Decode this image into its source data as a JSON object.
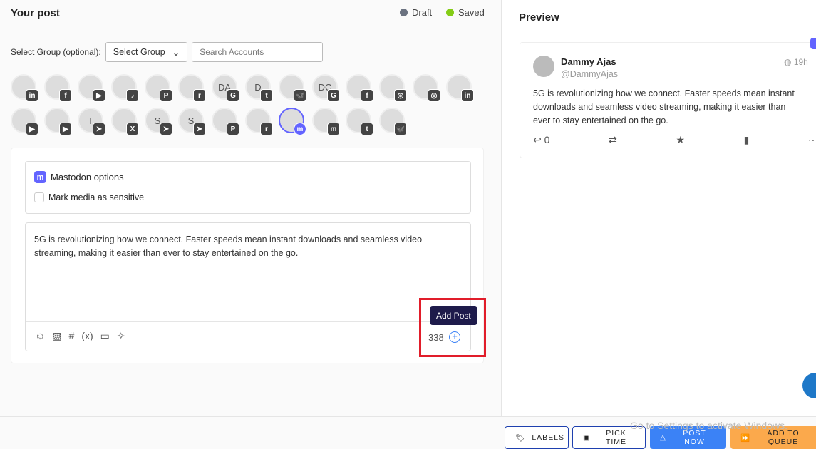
{
  "left": {
    "title": "Your post",
    "status": [
      {
        "label": "Draft",
        "color": "#6b7280"
      },
      {
        "label": "Saved",
        "color": "#84cc16"
      }
    ],
    "group_label": "Select Group (optional):",
    "group_select": "Select Group",
    "search_placeholder": "Search Accounts",
    "accounts": [
      {
        "initials": "",
        "platform": "linkedin",
        "badge": "in"
      },
      {
        "initials": "",
        "platform": "facebook",
        "badge": "f"
      },
      {
        "initials": "",
        "platform": "youtube",
        "badge": "▶"
      },
      {
        "initials": "",
        "platform": "tiktok",
        "badge": "♪"
      },
      {
        "initials": "",
        "platform": "pinterest",
        "badge": "P"
      },
      {
        "initials": "",
        "platform": "reddit",
        "badge": "r"
      },
      {
        "initials": "DA",
        "platform": "google-business",
        "badge": "G"
      },
      {
        "initials": "D",
        "platform": "tumblr",
        "badge": "t"
      },
      {
        "initials": "",
        "platform": "bluesky",
        "badge": "🦋"
      },
      {
        "initials": "DC",
        "platform": "google-business",
        "badge": "G"
      },
      {
        "initials": "",
        "platform": "facebook",
        "badge": "f"
      },
      {
        "initials": "",
        "platform": "instagram",
        "badge": "◎"
      },
      {
        "initials": "",
        "platform": "instagram",
        "badge": "◎"
      },
      {
        "initials": "",
        "platform": "linkedin",
        "badge": "in"
      },
      {
        "initials": "",
        "platform": "youtube",
        "badge": "▶"
      },
      {
        "initials": "",
        "platform": "youtube",
        "badge": "▶"
      },
      {
        "initials": "I",
        "platform": "telegram",
        "badge": "➤"
      },
      {
        "initials": "",
        "platform": "x",
        "badge": "X"
      },
      {
        "initials": "S",
        "platform": "telegram",
        "badge": "➤"
      },
      {
        "initials": "S",
        "platform": "telegram",
        "badge": "➤"
      },
      {
        "initials": "",
        "platform": "pinterest",
        "badge": "P"
      },
      {
        "initials": "",
        "platform": "reddit",
        "badge": "r"
      },
      {
        "initials": "",
        "platform": "mastodon",
        "badge": "m",
        "selected": true
      },
      {
        "initials": "",
        "platform": "mastodon",
        "badge": "m"
      },
      {
        "initials": "",
        "platform": "tumblr",
        "badge": "t"
      },
      {
        "initials": "",
        "platform": "bluesky",
        "badge": "🦋"
      }
    ],
    "mastodon_title": "Mastodon options",
    "sensitive_label": "Mark media as sensitive",
    "post_text": "5G is revolutionizing how we connect. Faster speeds mean instant downloads and seamless video streaming, making it easier than ever to stay entertained on the go.",
    "char_count": "338",
    "tooltip": "Add Post"
  },
  "preview": {
    "title": "Preview",
    "name": "Dammy Ajas",
    "handle": "@DammyAjas",
    "time": "19h",
    "text": "5G is revolutionizing how we connect. Faster speeds mean instant downloads and seamless video streaming, making it easier than ever to stay entertained on the go.",
    "replies": "0"
  },
  "footer": {
    "labels": "LABELS",
    "pick_time": "PICK TIME",
    "post_now": "POST NOW",
    "add_queue": "ADD TO QUEUE",
    "watermark": "Go to Settings to activate Windows."
  }
}
